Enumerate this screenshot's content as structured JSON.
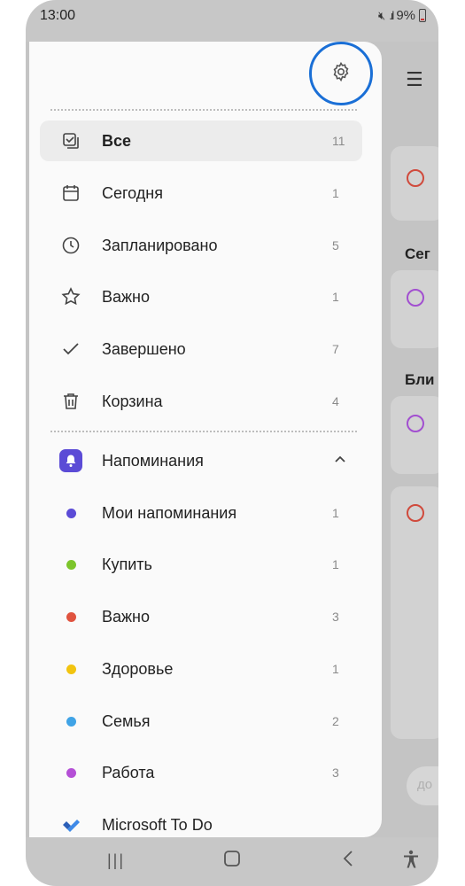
{
  "status": {
    "time": "13:00",
    "battery": "9%"
  },
  "background": {
    "section_today": "Сег",
    "section_near": "Бли",
    "faded_text": "до"
  },
  "drawer": {
    "smart_lists": [
      {
        "label": "Все",
        "count": "11",
        "icon": "all-tasks-icon",
        "selected": true
      },
      {
        "label": "Сегодня",
        "count": "1",
        "icon": "calendar-icon"
      },
      {
        "label": "Запланировано",
        "count": "5",
        "icon": "clock-icon"
      },
      {
        "label": "Важно",
        "count": "1",
        "icon": "star-icon"
      },
      {
        "label": "Завершено",
        "count": "7",
        "icon": "checkmark-icon"
      },
      {
        "label": "Корзина",
        "count": "4",
        "icon": "trash-icon"
      }
    ],
    "reminders_group": {
      "label": "Напоминания",
      "icon": "bell-icon",
      "color": "#5b4bd6"
    },
    "reminder_lists": [
      {
        "label": "Мои напоминания",
        "count": "1",
        "color": "#5b4bd6"
      },
      {
        "label": "Купить",
        "count": "1",
        "color": "#7cc52b"
      },
      {
        "label": "Важно",
        "count": "3",
        "color": "#e0533f"
      },
      {
        "label": "Здоровье",
        "count": "1",
        "color": "#f2c40f"
      },
      {
        "label": "Семья",
        "count": "2",
        "color": "#3fa3e6"
      },
      {
        "label": "Работа",
        "count": "3",
        "color": "#b44fd6"
      }
    ],
    "microsoft": {
      "label": "Microsoft To Do",
      "icon": "microsoft-todo-icon"
    }
  },
  "colors": {
    "highlight_ring": "#1a6fd6"
  }
}
